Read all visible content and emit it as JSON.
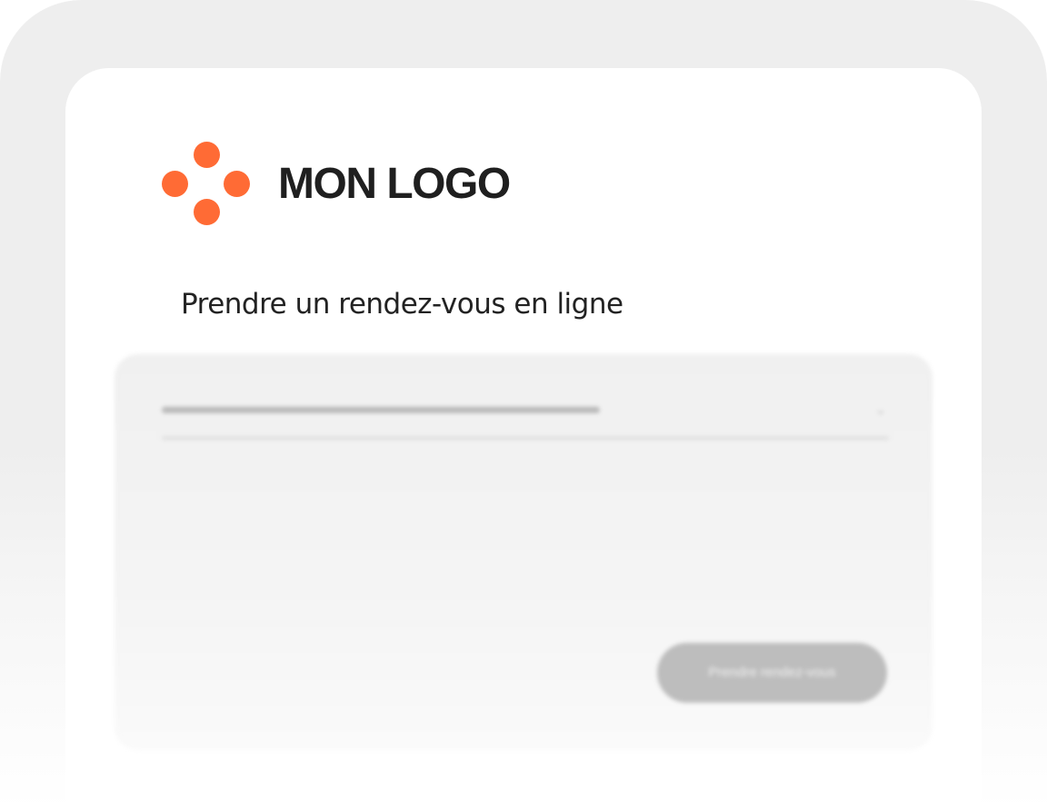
{
  "logo": {
    "text": "MON LOGO",
    "mark_color": "#FF6B35",
    "icon": "four-dots-logo-icon"
  },
  "page": {
    "subtitle": "Prendre un rendez-vous en ligne"
  },
  "form": {
    "select": {
      "chevron_icon": "chevron-down-icon",
      "chevron_glyph": "⌄"
    },
    "submit_label": "Prendre rendez-vous"
  },
  "colors": {
    "background_frame": "#EEEEEE",
    "screen": "#FFFFFF",
    "text": "#222222",
    "accent": "#FF6B35"
  }
}
